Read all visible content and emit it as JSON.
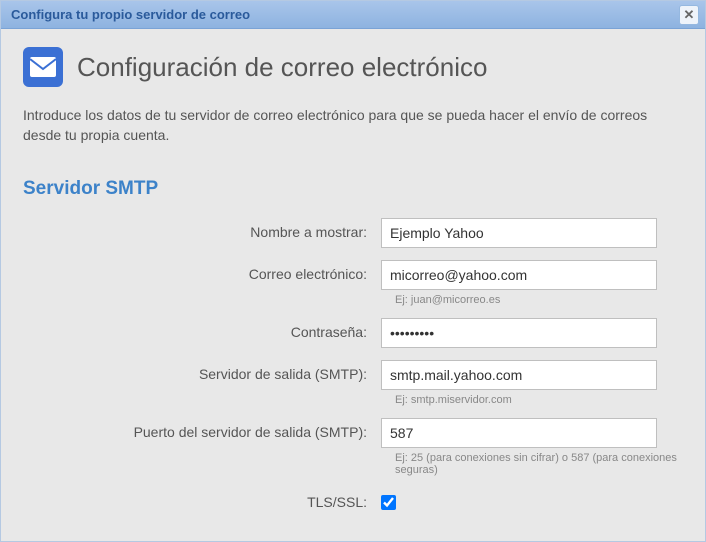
{
  "titlebar": {
    "title": "Configura tu propio servidor de correo"
  },
  "header": {
    "title": "Configuración de correo electrónico"
  },
  "intro": "Introduce los datos de tu servidor de correo electrónico para que se pueda hacer el envío de correos desde tu propia cuenta.",
  "section": {
    "title": "Servidor SMTP"
  },
  "fields": {
    "display_name": {
      "label": "Nombre a mostrar:",
      "value": "Ejemplo Yahoo"
    },
    "email": {
      "label": "Correo electrónico:",
      "value": "micorreo@yahoo.com",
      "hint": "Ej: juan@micorreo.es"
    },
    "password": {
      "label": "Contraseña:",
      "value": "•••••••••"
    },
    "smtp_server": {
      "label": "Servidor de salida (SMTP):",
      "value": "smtp.mail.yahoo.com",
      "hint": "Ej: smtp.miservidor.com"
    },
    "smtp_port": {
      "label": "Puerto del servidor de salida (SMTP):",
      "value": "587",
      "hint": "Ej: 25 (para conexiones sin cifrar) o 587 (para conexiones seguras)"
    },
    "tls": {
      "label": "TLS/SSL:",
      "checked": true
    }
  }
}
